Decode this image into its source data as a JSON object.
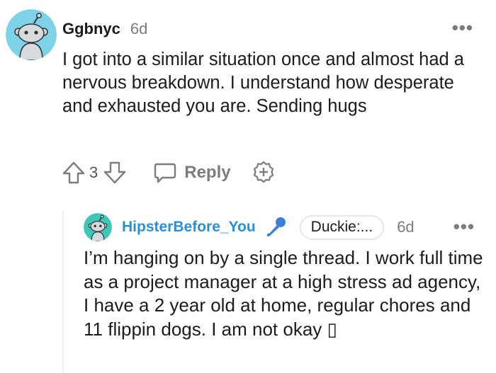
{
  "comment": {
    "username": "Ggbnyc",
    "time": "6d",
    "body": "I got into a similar situation once and almost had a nervous breakdown. I understand how desperate and exhausted you are. Sending hugs",
    "vote_count": "3",
    "reply_label": "Reply",
    "overflow": "•••"
  },
  "reply": {
    "username": "HipsterBefore_You",
    "flair": "Duckie:...",
    "time": "6d",
    "body": "I’m hanging on by a single thread. I work full time as a project manager at a high stress ad agency, I have a 2 year old at home, regular chores and 11 flippin dogs. I am not okay ▯",
    "overflow": "•••"
  },
  "icons": {
    "avatar": "snoo-avatar-icon",
    "upvote": "upvote-arrow-icon",
    "downvote": "downvote-arrow-icon",
    "reply": "speech-bubble-icon",
    "award": "award-plus-icon",
    "flair_emoji": "microphone-icon",
    "more": "overflow-menu-icon"
  },
  "colors": {
    "avatar_bg": "#7fd3e8",
    "username_link": "#2b8fd6",
    "muted": "#7c7c7c",
    "text": "#1c1c1c",
    "mic": "#3b7fd8"
  }
}
